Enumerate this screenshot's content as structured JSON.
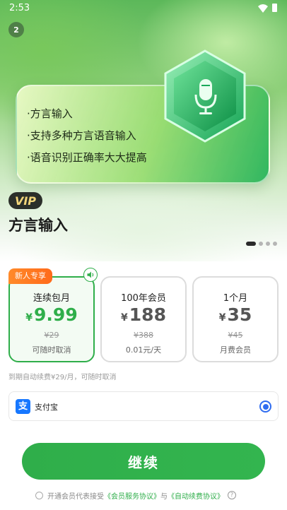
{
  "status_bar": {
    "time": "2:53",
    "icons": [
      "wifi-icon",
      "battery-icon"
    ]
  },
  "hero": {
    "badge_count": "2",
    "features": [
      "·方言输入",
      "·支持多种方言语音输入",
      "·语音识别正确率大大提高"
    ],
    "feature_icon": "microphone-icon",
    "vip_label": "VIP",
    "title": "方言输入",
    "pager": {
      "total": 4,
      "active_index": 0
    }
  },
  "plans": [
    {
      "name": "连续包月",
      "currency": "¥",
      "price": "9.99",
      "original": "¥29",
      "note": "可随时取消",
      "selected": true,
      "tag": "新人专享"
    },
    {
      "name": "100年会员",
      "currency": "¥",
      "price": "188",
      "original": "¥388",
      "note": "0.01元/天",
      "selected": false
    },
    {
      "name": "1个月",
      "currency": "¥",
      "price": "35",
      "original": "¥45",
      "note": "月费会员",
      "selected": false
    }
  ],
  "auto_renew_note": "到期自动续费¥29/月，可随时取消",
  "payment": {
    "method": "支付宝",
    "icon": "alipay-icon",
    "icon_glyph": "支",
    "selected": true
  },
  "continue_label": "继续",
  "agreement": {
    "prefix": "开通会员代表接受",
    "link1": "《会员服务协议》",
    "conj": "与",
    "link2": "《自动续费协议》",
    "help_glyph": "?"
  },
  "colors": {
    "accent": "#2fae4a",
    "tag": "#ff7a1a",
    "radio": "#2f6cf0",
    "alipay": "#1677ff"
  }
}
